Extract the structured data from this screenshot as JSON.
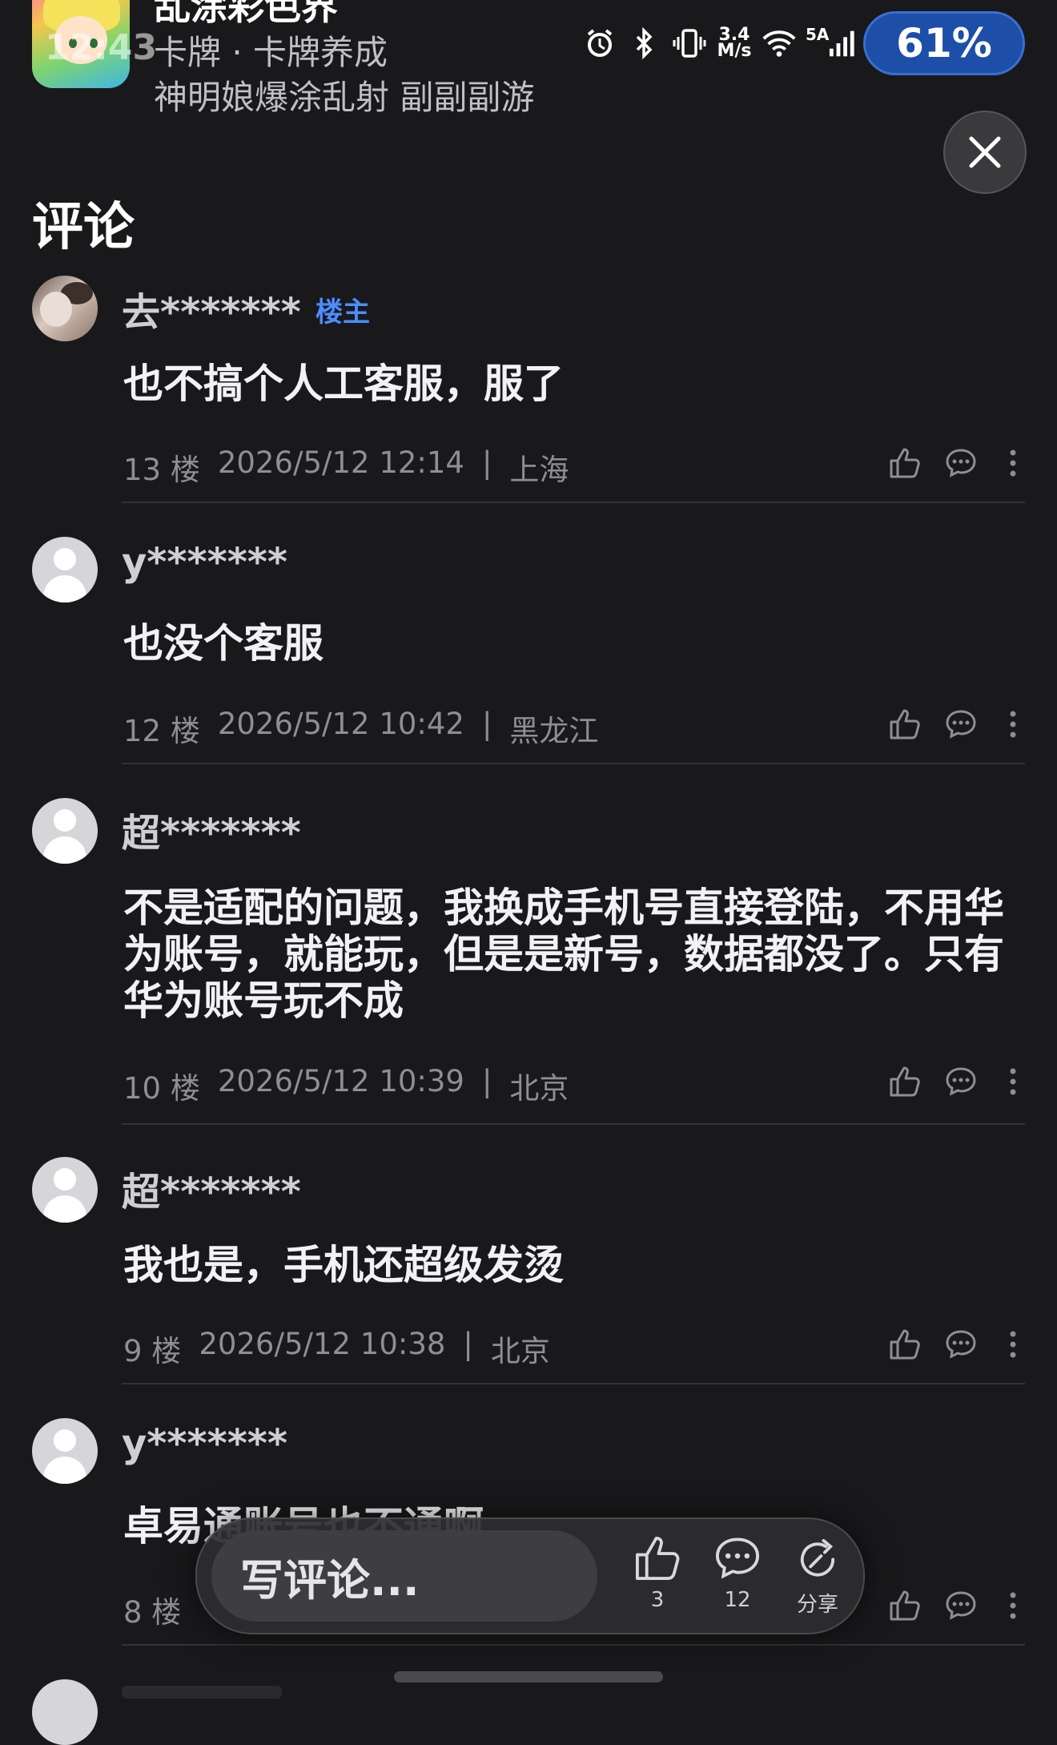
{
  "header": {
    "app_name": "乱涂彩色界",
    "category": "卡牌 · 卡牌养成",
    "tags": "神明娘爆涂乱射 副副副游",
    "status_time": "12:43"
  },
  "status_bar": {
    "network_speed_top": "3.4",
    "network_speed_bottom": "M/s",
    "signal_label": "5A",
    "battery": "61%"
  },
  "section_title": "评论",
  "op_badge": "楼主",
  "comments": [
    {
      "user": "去*******",
      "is_op": true,
      "text": "也不搞个人工客服，服了",
      "floor": "13 楼",
      "time": "2026/5/12 12:14",
      "sep": "|",
      "location": "上海"
    },
    {
      "user": "y*******",
      "is_op": false,
      "text": "也没个客服",
      "floor": "12 楼",
      "time": "2026/5/12 10:42",
      "sep": "|",
      "location": "黑龙江"
    },
    {
      "user": "超*******",
      "is_op": false,
      "text": "不是适配的问题，我换成手机号直接登陆，不用华为账号，就能玩，但是是新号，数据都没了。只有华为账号玩不成",
      "floor": "10 楼",
      "time": "2026/5/12 10:39",
      "sep": "|",
      "location": "北京"
    },
    {
      "user": "超*******",
      "is_op": false,
      "text": "我也是，手机还超级发烫",
      "floor": "9 楼",
      "time": "2026/5/12 10:38",
      "sep": "|",
      "location": "北京"
    },
    {
      "user": "y*******",
      "is_op": false,
      "text": "卓易通账号也不通啊",
      "floor": "8 楼",
      "time": "",
      "sep": "",
      "location": ""
    }
  ],
  "bottom_bar": {
    "placeholder": "写评论...",
    "like_count": "3",
    "comment_count": "12",
    "share_label": "分享"
  }
}
